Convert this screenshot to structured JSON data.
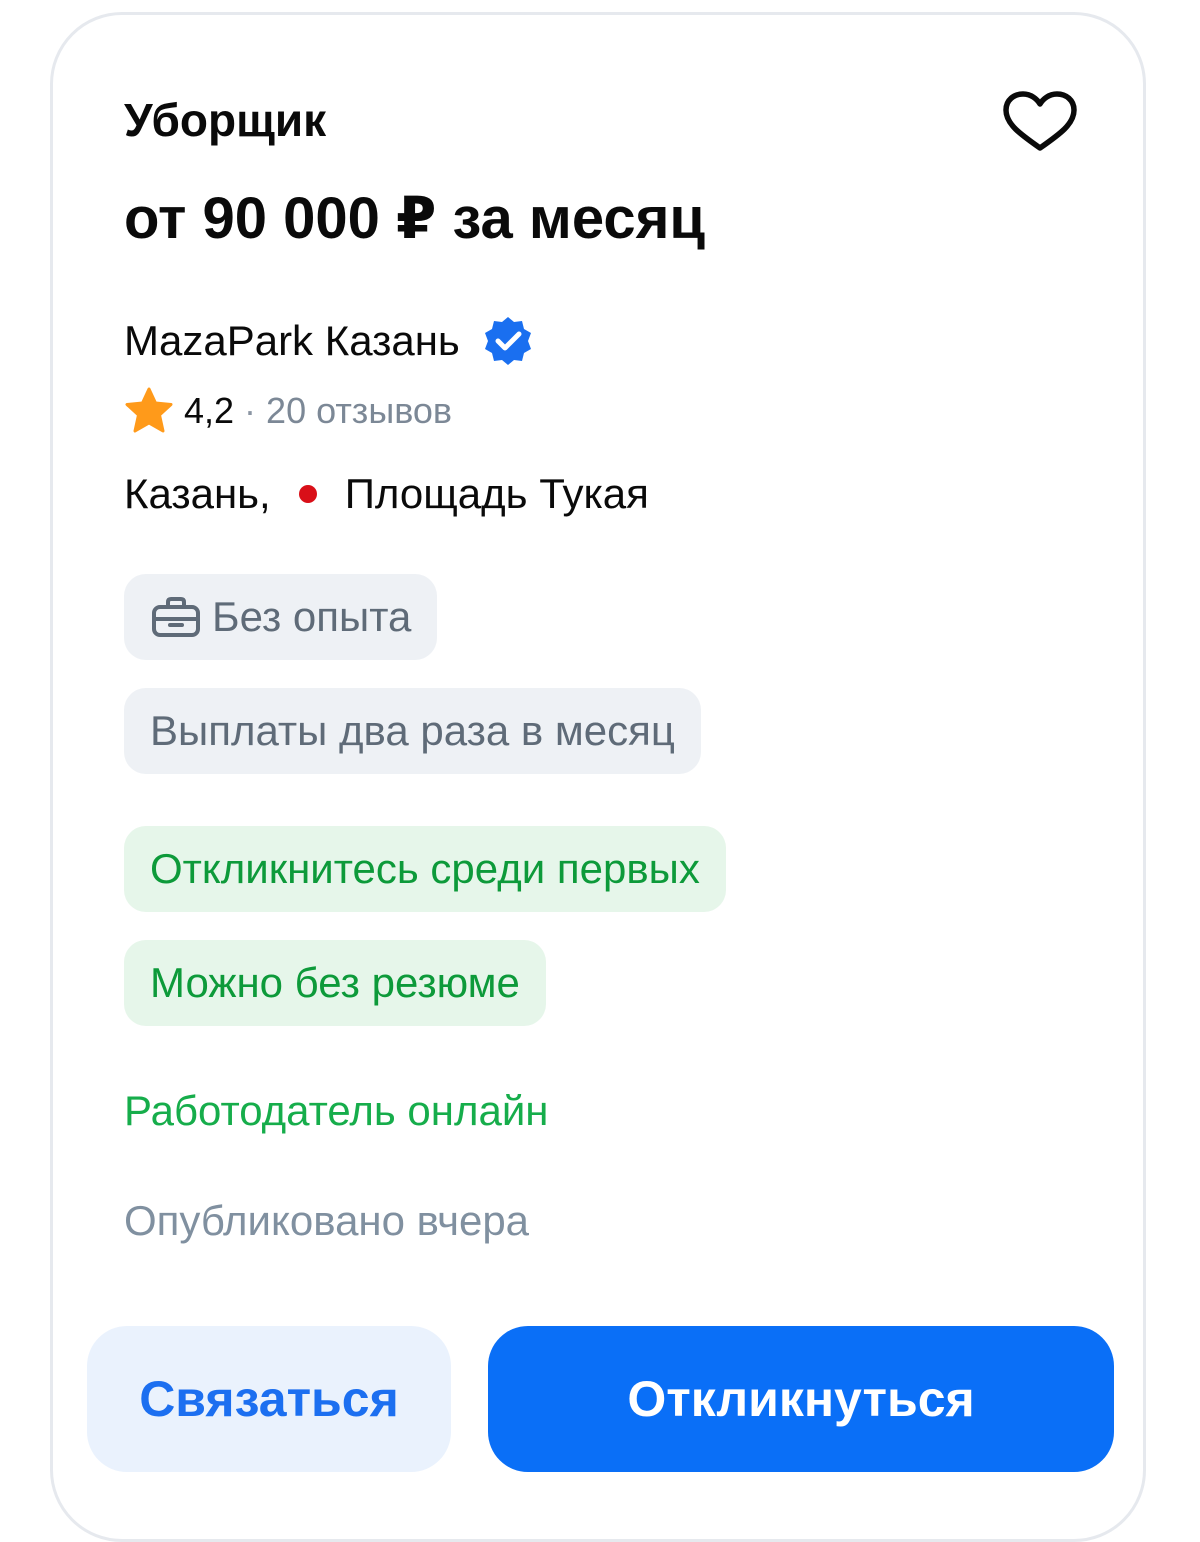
{
  "vacancy": {
    "title": "Уборщик",
    "salary": "от 90 000 ₽ за месяц"
  },
  "company": {
    "name": "MazaPark Казань",
    "verified_icon": "verified-badge-icon",
    "rating": "4,2",
    "rating_separator": "·",
    "reviews": "20 отзывов",
    "star_color": "#ff9a1a",
    "verified_color": "#1a6ff0"
  },
  "location": {
    "city": "Казань,",
    "metro": "Площадь Тукая",
    "metro_color": "#d90f18"
  },
  "chips": {
    "experience": "Без опыта",
    "payments": "Выплаты два раза в месяц",
    "respond_first": "Откликнитесь среди первых",
    "no_resume": "Можно без резюме"
  },
  "status": {
    "employer_online": "Работодатель онлайн",
    "published": "Опубликовано вчера"
  },
  "actions": {
    "contact_label": "Связаться",
    "apply_label": "Откликнуться"
  },
  "colors": {
    "accent": "#0a6ff7",
    "green": "#0d9a3a",
    "online_green": "#16ad4b"
  }
}
